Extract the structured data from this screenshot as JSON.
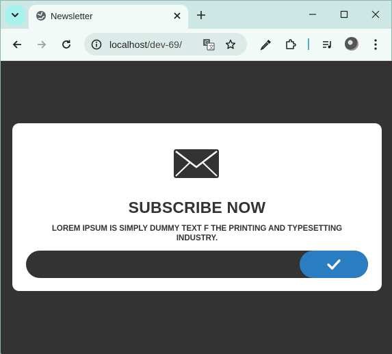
{
  "browser": {
    "tab": {
      "title": "Newsletter",
      "icon": "globe-icon"
    },
    "url": {
      "host": "localhost",
      "path": "/dev-69/"
    },
    "accent": "#a5f3ec"
  },
  "newsletter": {
    "icon": "envelope-icon",
    "headline": "SUBSCRIBE NOW",
    "description": "LOREM IPSUM IS SIMPLY DUMMY TEXT F THE PRINTING AND TYPESETTING INDUSTRY.",
    "email_value": "",
    "submit_icon": "checkmark-icon",
    "colors": {
      "page_background": "#333333",
      "card_background": "#ffffff",
      "button": "#2b7dc1",
      "text": "#333333"
    }
  }
}
